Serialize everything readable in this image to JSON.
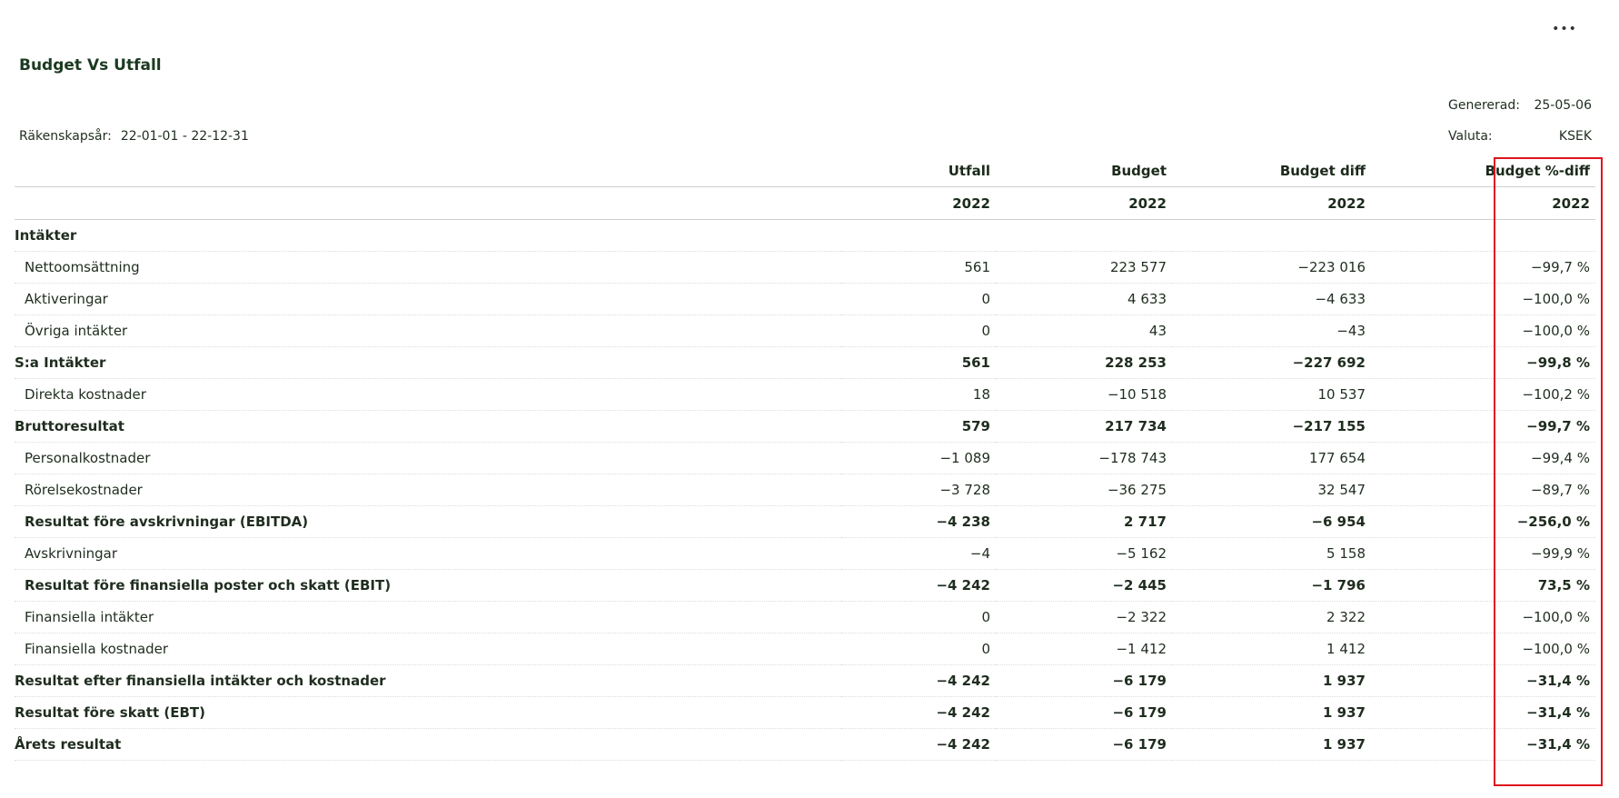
{
  "report": {
    "title": "Budget Vs Utfall",
    "menu_icon": "ellipsis-icon",
    "menu_glyph": "•••",
    "generated_label": "Genererad:",
    "generated_value": "25-05-06",
    "currency_label": "Valuta:",
    "currency_value": "KSEK",
    "fiscal_label": "Räkenskapsår:",
    "fiscal_value": "22-01-01 - 22-12-31"
  },
  "columns": [
    {
      "header": "Utfall",
      "year": "2022"
    },
    {
      "header": "Budget",
      "year": "2022"
    },
    {
      "header": "Budget diff",
      "year": "2022"
    },
    {
      "header": "Budget %-diff",
      "year": "2022"
    }
  ],
  "highlight_color": "#e0141e",
  "rows": [
    {
      "label": "Intäkter",
      "values": [
        "",
        "",
        "",
        ""
      ],
      "style": "section"
    },
    {
      "label": "Nettoomsättning",
      "values": [
        "561",
        "223 577",
        "−223 016",
        "−99,7 %"
      ],
      "style": "indent"
    },
    {
      "label": "Aktiveringar",
      "values": [
        "0",
        "4 633",
        "−4 633",
        "−100,0 %"
      ],
      "style": "indent"
    },
    {
      "label": "Övriga intäkter",
      "values": [
        "0",
        "43",
        "−43",
        "−100,0 %"
      ],
      "style": "indent"
    },
    {
      "label": "S:a Intäkter",
      "values": [
        "561",
        "228 253",
        "−227 692",
        "−99,8 %"
      ],
      "style": "bold"
    },
    {
      "label": "Direkta kostnader",
      "values": [
        "18",
        "−10 518",
        "10 537",
        "−100,2 %"
      ],
      "style": "indent"
    },
    {
      "label": "Bruttoresultat",
      "values": [
        "579",
        "217 734",
        "−217 155",
        "−99,7 %"
      ],
      "style": "bold"
    },
    {
      "label": "Personalkostnader",
      "values": [
        "−1 089",
        "−178 743",
        "177 654",
        "−99,4 %"
      ],
      "style": "indent"
    },
    {
      "label": "Rörelsekostnader",
      "values": [
        "−3 728",
        "−36 275",
        "32 547",
        "−89,7 %"
      ],
      "style": "indent"
    },
    {
      "label": "Resultat före avskrivningar (EBITDA)",
      "values": [
        "−4 238",
        "2 717",
        "−6 954",
        "−256,0 %"
      ],
      "style": "indent bold"
    },
    {
      "label": "Avskrivningar",
      "values": [
        "−4",
        "−5 162",
        "5 158",
        "−99,9 %"
      ],
      "style": "indent"
    },
    {
      "label": "Resultat före finansiella poster och skatt (EBIT)",
      "values": [
        "−4 242",
        "−2 445",
        "−1 796",
        "73,5 %"
      ],
      "style": "indent bold"
    },
    {
      "label": "Finansiella intäkter",
      "values": [
        "0",
        "−2 322",
        "2 322",
        "−100,0 %"
      ],
      "style": "indent"
    },
    {
      "label": "Finansiella kostnader",
      "values": [
        "0",
        "−1 412",
        "1 412",
        "−100,0 %"
      ],
      "style": "indent"
    },
    {
      "label": "Resultat efter finansiella intäkter och kostnader",
      "values": [
        "−4 242",
        "−6 179",
        "1 937",
        "−31,4 %"
      ],
      "style": "bold"
    },
    {
      "label": "Resultat före skatt (EBT)",
      "values": [
        "−4 242",
        "−6 179",
        "1 937",
        "−31,4 %"
      ],
      "style": "bold"
    },
    {
      "label": "Årets resultat",
      "values": [
        "−4 242",
        "−6 179",
        "1 937",
        "−31,4 %"
      ],
      "style": "bold"
    }
  ]
}
